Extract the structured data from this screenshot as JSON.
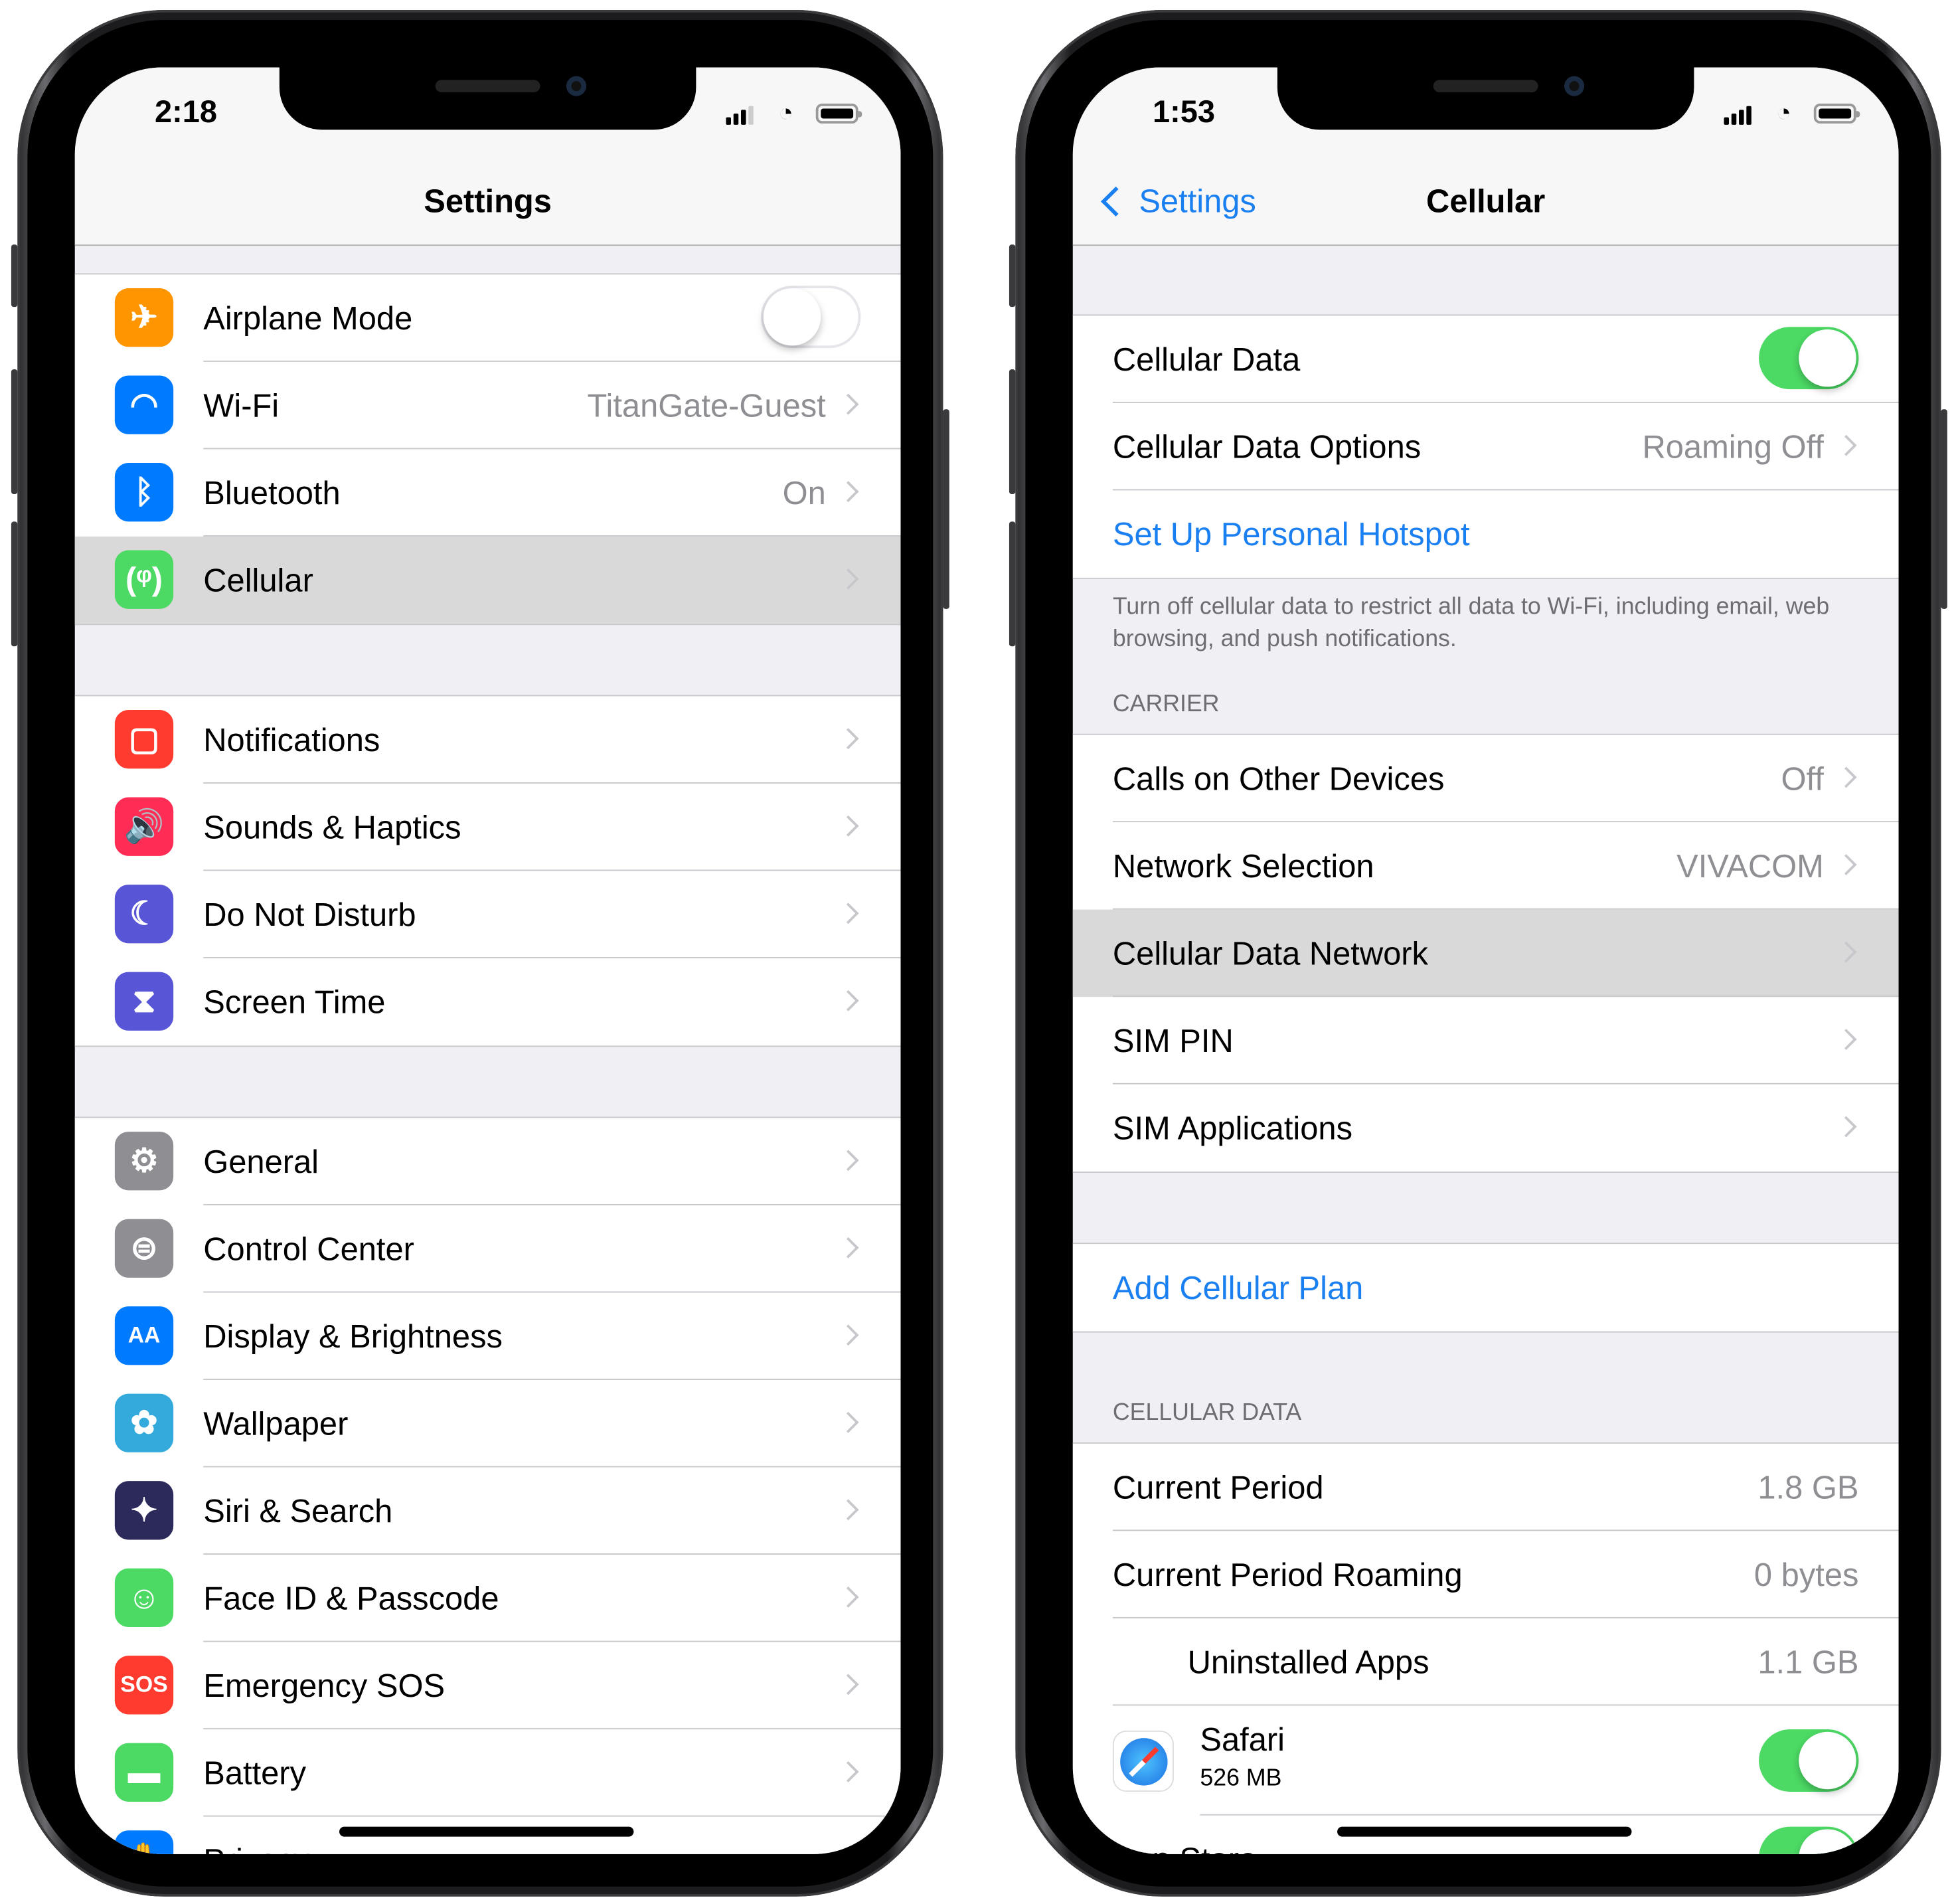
{
  "left_phone": {
    "status": {
      "time": "2:18"
    },
    "nav": {
      "title": "Settings"
    },
    "groups": [
      [
        {
          "label": "Airplane Mode",
          "icon": "airplane-icon",
          "icon_glyph": "✈",
          "icon_color": "#ff9500",
          "toggle": "off"
        },
        {
          "label": "Wi-Fi",
          "icon": "wifi-icon",
          "icon_glyph": "◠",
          "icon_color": "#007aff",
          "value": "TitanGate-Guest"
        },
        {
          "label": "Bluetooth",
          "icon": "bluetooth-icon",
          "icon_glyph": "ᛒ",
          "icon_color": "#007aff",
          "value": "On"
        },
        {
          "label": "Cellular",
          "icon": "cellular-antenna-icon",
          "icon_glyph": "(ᵠ)",
          "icon_color": "#4cd964",
          "selected": true
        }
      ],
      [
        {
          "label": "Notifications",
          "icon": "notifications-icon",
          "icon_glyph": "▢",
          "icon_color": "#ff3b30"
        },
        {
          "label": "Sounds & Haptics",
          "icon": "speaker-icon",
          "icon_glyph": "🔊",
          "icon_color": "#ff2d55"
        },
        {
          "label": "Do Not Disturb",
          "icon": "moon-icon",
          "icon_glyph": "☾",
          "icon_color": "#5856d6"
        },
        {
          "label": "Screen Time",
          "icon": "hourglass-icon",
          "icon_glyph": "⧗",
          "icon_color": "#5856d6"
        }
      ],
      [
        {
          "label": "General",
          "icon": "gear-icon",
          "icon_glyph": "⚙",
          "icon_color": "#8e8e93"
        },
        {
          "label": "Control Center",
          "icon": "switches-icon",
          "icon_glyph": "⊜",
          "icon_color": "#8e8e93"
        },
        {
          "label": "Display & Brightness",
          "icon": "text-size-icon",
          "icon_glyph": "AA",
          "icon_color": "#007aff"
        },
        {
          "label": "Wallpaper",
          "icon": "flower-icon",
          "icon_glyph": "✿",
          "icon_color": "#34aadc"
        },
        {
          "label": "Siri & Search",
          "icon": "siri-icon",
          "icon_glyph": "✦",
          "icon_color": "#2c2a5a"
        },
        {
          "label": "Face ID & Passcode",
          "icon": "face-id-icon",
          "icon_glyph": "☺",
          "icon_color": "#4cd964"
        },
        {
          "label": "Emergency SOS",
          "icon": "sos-icon",
          "icon_glyph": "SOS",
          "icon_color": "#ff3b30"
        },
        {
          "label": "Battery",
          "icon": "battery-icon",
          "icon_glyph": "▬",
          "icon_color": "#4cd964"
        },
        {
          "label": "Privacy",
          "icon": "privacy-hand-icon",
          "icon_glyph": "✋",
          "icon_color": "#007aff"
        }
      ]
    ]
  },
  "right_phone": {
    "status": {
      "time": "1:53"
    },
    "nav": {
      "back_label": "Settings",
      "title": "Cellular"
    },
    "group1": [
      {
        "label": "Cellular Data",
        "toggle": "on"
      },
      {
        "label": "Cellular Data Options",
        "value": "Roaming Off",
        "chevron": true
      },
      {
        "label": "Set Up Personal Hotspot",
        "link": true
      }
    ],
    "group1_footer": "Turn off cellular data to restrict all data to Wi-Fi, including email, web browsing, and push notifications.",
    "carrier_header": "CARRIER",
    "group2": [
      {
        "label": "Calls on Other Devices",
        "value": "Off",
        "chevron": true
      },
      {
        "label": "Network Selection",
        "value": "VIVACOM",
        "chevron": true
      },
      {
        "label": "Cellular Data Network",
        "chevron": true,
        "selected": true
      },
      {
        "label": "SIM PIN",
        "chevron": true
      },
      {
        "label": "SIM Applications",
        "chevron": true
      }
    ],
    "group3": [
      {
        "label": "Add Cellular Plan",
        "link": true
      }
    ],
    "cellular_data_header": "CELLULAR DATA",
    "group4": [
      {
        "label": "Current Period",
        "value": "1.8 GB"
      },
      {
        "label": "Current Period Roaming",
        "value": "0 bytes"
      },
      {
        "label": "Uninstalled Apps",
        "value": "1.1 GB",
        "indent": true
      },
      {
        "label": "Safari",
        "sub": "526 MB",
        "icon": "safari-compass-icon",
        "toggle": "on"
      },
      {
        "label": "App Store",
        "toggle": "on"
      }
    ]
  }
}
